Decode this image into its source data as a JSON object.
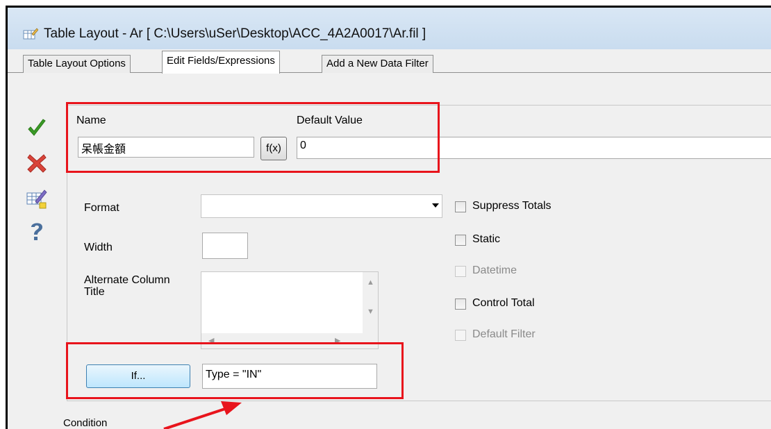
{
  "window": {
    "title": "Table Layout - Ar [ C:\\Users\\uSer\\Desktop\\ACC_4A2A0017\\Ar.fil ]",
    "icon": "table-layout-icon"
  },
  "tabs": [
    {
      "label": "Table Layout Options",
      "active": false
    },
    {
      "label": "Edit Fields/Expressions",
      "active": true
    },
    {
      "label": "Add a New Data Filter",
      "active": false
    }
  ],
  "sidebar": {
    "buttons": [
      {
        "name": "ok-checkmark-icon",
        "color": "#3a9a26"
      },
      {
        "name": "cancel-x-icon",
        "color": "#d9443a"
      },
      {
        "name": "edit-table-icon"
      },
      {
        "name": "help-question-icon",
        "color": "#4a6f9c"
      }
    ]
  },
  "fields": {
    "name_label": "Name",
    "name_value": "呆帳金額",
    "default_value_label": "Default Value",
    "fx_button": "f(x)",
    "default_value": "0",
    "format_label": "Format",
    "format_value": "",
    "width_label": "Width",
    "width_value": "",
    "alt_title_label_line1": "Alternate Column",
    "alt_title_label_line2": "Title",
    "alt_title_value": "",
    "if_button": "If...",
    "condition_value": "Type = \"IN\"",
    "condition_label": "Condition"
  },
  "checkboxes": [
    {
      "label": "Suppress Totals",
      "checked": false,
      "enabled": true
    },
    {
      "label": "Static",
      "checked": false,
      "enabled": true
    },
    {
      "label": "Datetime",
      "checked": false,
      "enabled": false
    },
    {
      "label": "Control Total",
      "checked": false,
      "enabled": true
    },
    {
      "label": "Default Filter",
      "checked": false,
      "enabled": false
    }
  ],
  "annotation_color": "#e8141c"
}
